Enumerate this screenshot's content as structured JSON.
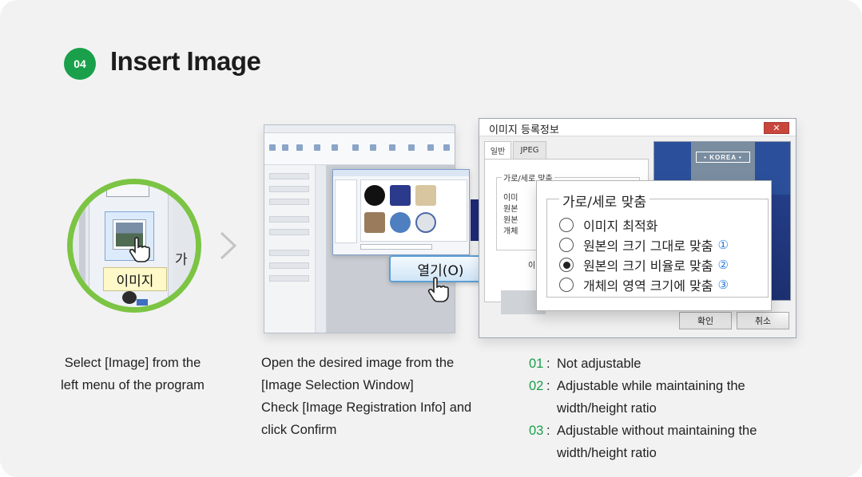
{
  "step": {
    "number": "04",
    "title": "Insert Image"
  },
  "zoom": {
    "menu_label": "이미지",
    "side_text": "가"
  },
  "file_dialog": {
    "open_button_label": "열기(O)"
  },
  "image_dialog": {
    "title": "이미지 등록정보",
    "close_label": "✕",
    "tabs": [
      {
        "label": "일반"
      },
      {
        "label": "JPEG"
      }
    ],
    "group_title_small": "가로/세로 맞춤",
    "small_options": [
      "이미",
      "원본",
      "원본",
      "개체"
    ],
    "small_side_text": "이미",
    "picture_text": "• KOREA •",
    "ok_label": "확인",
    "cancel_label": "취소"
  },
  "options_zoom": {
    "group_title": "가로/세로 맞춤",
    "options": [
      {
        "label": "이미지 최적화",
        "marker": "",
        "selected": false
      },
      {
        "label": "원본의 크기 그대로 맞춤",
        "marker": "①",
        "selected": false
      },
      {
        "label": "원본의 크기 비율로 맞춤",
        "marker": "②",
        "selected": true
      },
      {
        "label": "개체의 영역 크기에 맞춤",
        "marker": "③",
        "selected": false
      }
    ]
  },
  "captions": {
    "step1": [
      "Select [Image] from the",
      "left menu of the program"
    ],
    "step2": [
      "Open the desired image from the",
      "[Image Selection Window]",
      "Check [Image Registration Info] and",
      "click Confirm"
    ],
    "notes": [
      {
        "no": "01",
        "sep": ":",
        "lines": [
          "Not adjustable"
        ]
      },
      {
        "no": "02",
        "sep": ":",
        "lines": [
          "Adjustable while maintaining the",
          "width/height ratio"
        ]
      },
      {
        "no": "03",
        "sep": ":",
        "lines": [
          "Adjustable without maintaining the",
          "width/height ratio"
        ]
      }
    ]
  },
  "colors": {
    "accent_green": "#1aa04a",
    "ring_green": "#7cc443",
    "marker_blue": "#2f7fe0",
    "close_red": "#c9463d"
  }
}
